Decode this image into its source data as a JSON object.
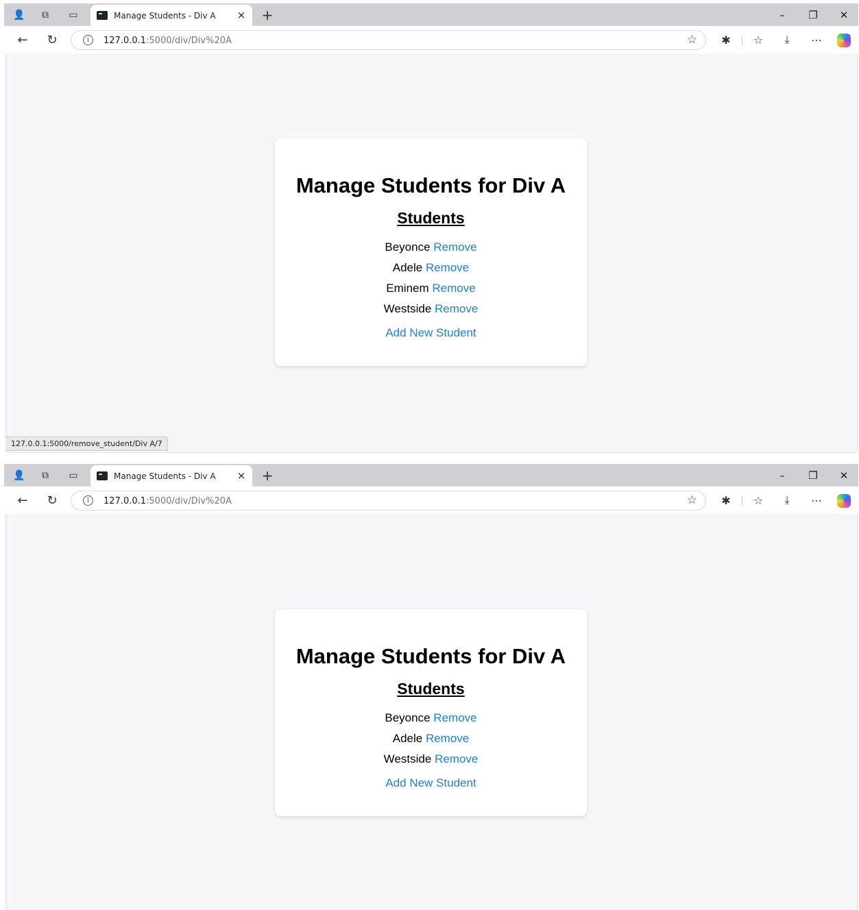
{
  "screens": [
    {
      "tab": {
        "title": "Manage Students - Div A",
        "close": "×"
      },
      "address": {
        "host": "127.0.0.1",
        "path": ":5000/div/Div%20A"
      },
      "page": {
        "heading": "Manage Students for Div A",
        "subheading": "Students",
        "students": [
          {
            "name": "Beyonce",
            "action": "Remove"
          },
          {
            "name": "Adele",
            "action": "Remove"
          },
          {
            "name": "Eminem",
            "action": "Remove"
          },
          {
            "name": "Westside",
            "action": "Remove"
          }
        ],
        "add_link": "Add New Student"
      },
      "status_url": "127.0.0.1:5000/remove_student/Div A/7"
    },
    {
      "tab": {
        "title": "Manage Students - Div A",
        "close": "×"
      },
      "address": {
        "host": "127.0.0.1",
        "path": ":5000/div/Div%20A"
      },
      "page": {
        "heading": "Manage Students for Div A",
        "subheading": "Students",
        "students": [
          {
            "name": "Beyonce",
            "action": "Remove"
          },
          {
            "name": "Adele",
            "action": "Remove"
          },
          {
            "name": "Westside",
            "action": "Remove"
          }
        ],
        "add_link": "Add New Student"
      }
    }
  ],
  "chrome_icons": {
    "profile": "👤",
    "workspaces": "⧉",
    "sidebar": "▭",
    "new_tab": "+",
    "minimize": "–",
    "restore": "❐",
    "close_window": "✕",
    "back": "←",
    "refresh": "↻",
    "info": "i",
    "favorite_star": "☆",
    "extensions": "✱",
    "favorites": "☆",
    "downloads": "⤓",
    "more": "⋯"
  },
  "colors": {
    "link": "#1a80e6",
    "page_bg": "#f6f6f9",
    "tabbar_bg": "#cfd0d3"
  }
}
